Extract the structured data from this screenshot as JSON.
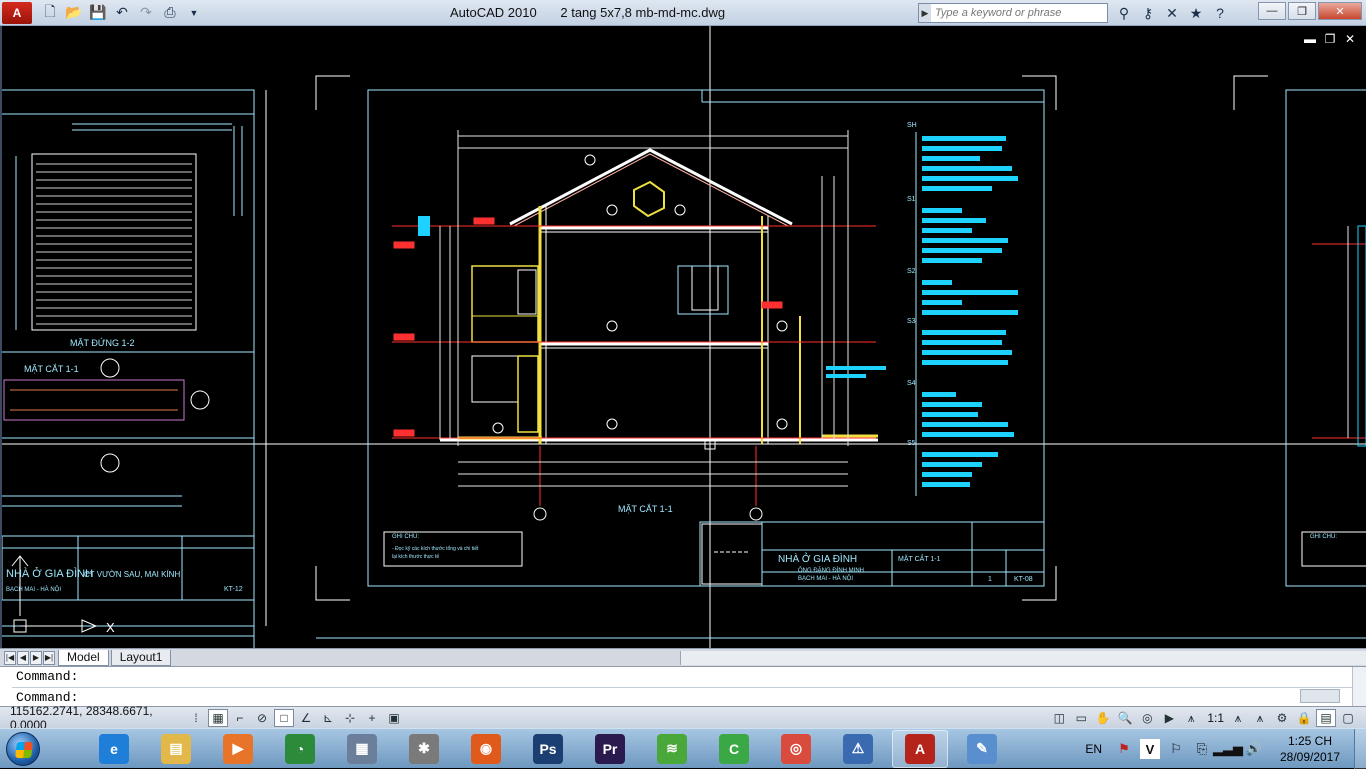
{
  "titlebar": {
    "app_name": "AutoCAD 2010",
    "file_name": "2 tang 5x7,8 mb-md-mc.dwg",
    "search_placeholder": "Type a keyword or phrase",
    "app_logo": "A"
  },
  "tabs": {
    "model": "Model",
    "layout1": "Layout1"
  },
  "command": {
    "line1": "Command:",
    "line2": "Command:"
  },
  "status": {
    "coordinates": "115162.2741, 28348.6671, 0.0000",
    "annotation_scale": "1:1"
  },
  "drawing": {
    "left_sheet_elevation_title": "MẶT ĐỨNG 1-2",
    "left_sheet_section_title": "MẶT CẮT 1-1",
    "left_sheet_project": "NHÀ Ở GIA ĐÌNH",
    "left_sheet_client": "CT VƯỜN SAU, MAI KÍNH",
    "left_sheet_address": "BẠCH MAI - HÀ NỘI",
    "left_sheet_code": "KT-12",
    "main_section_title": "MẶT CẮT 1-1",
    "main_project": "NHÀ Ở GIA ĐÌNH",
    "main_client": "ÔNG ĐẶNG ĐÌNH MINH",
    "main_address": "BẠCH MAI - HÀ NỘI",
    "main_sheet_title": "MẶT CẮT 1-1",
    "main_sheet_code": "KT-08",
    "main_sheet_number": "1",
    "notes_title": "GHI CHÚ:",
    "notes_text_1": "- Đọc kỹ các kích thước tổng và chi tiết",
    "notes_text_2": "  lại kích thước thực tế",
    "right_notes_title": "GHI CHÚ:",
    "layer_labels": [
      "SH",
      "S1",
      "S2",
      "S3",
      "S4",
      "S5"
    ]
  },
  "taskbar": {
    "language": "EN",
    "time": "1:25 CH",
    "date": "28/09/2017",
    "apps": [
      {
        "name": "internet-explorer",
        "glyph": "e",
        "color": "#1f7fd8"
      },
      {
        "name": "file-explorer",
        "glyph": "▤",
        "color": "#e3b84a"
      },
      {
        "name": "media-player",
        "glyph": "▶",
        "color": "#e8742a"
      },
      {
        "name": "coccoc-browser",
        "glyph": "◔",
        "color": "#2c8b3a"
      },
      {
        "name": "calculator",
        "glyph": "▦",
        "color": "#6b7f9a"
      },
      {
        "name": "settings-app",
        "glyph": "✱",
        "color": "#7a7a7a"
      },
      {
        "name": "firefox",
        "glyph": "◉",
        "color": "#e05a1c"
      },
      {
        "name": "photoshop",
        "glyph": "Ps",
        "color": "#1c3f73"
      },
      {
        "name": "premiere",
        "glyph": "Pr",
        "color": "#2a1a4d"
      },
      {
        "name": "wifi-app",
        "glyph": "≋",
        "color": "#4aa83b"
      },
      {
        "name": "camtasia",
        "glyph": "C",
        "color": "#3aa845"
      },
      {
        "name": "chrome",
        "glyph": "◎",
        "color": "#d94c3d"
      },
      {
        "name": "warning-app",
        "glyph": "⚠",
        "color": "#3a6ab0"
      },
      {
        "name": "autocad",
        "glyph": "A",
        "color": "#b4241a"
      },
      {
        "name": "paint",
        "glyph": "✎",
        "color": "#5a8fcf"
      }
    ]
  }
}
